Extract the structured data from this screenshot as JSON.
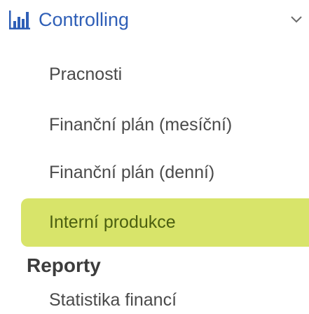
{
  "controlling": {
    "title": "Controlling",
    "icon": "bar-chart-icon",
    "expand_icon": "chevron-down-icon",
    "accent_color": "#2f5fb7",
    "items": [
      {
        "label": "Pracnosti",
        "active": false
      },
      {
        "label": "Finanční plán (mesíční)",
        "active": false
      },
      {
        "label": "Finanční plán (denní)",
        "active": false
      },
      {
        "label": "Interní produkce",
        "active": true
      }
    ]
  },
  "reporty": {
    "title": "Reporty",
    "items": [
      {
        "label": "Statistika financí"
      }
    ]
  },
  "colors": {
    "active_background": "#d8e46a",
    "active_text": "#4b5f10",
    "item_text": "#4a4a4a"
  }
}
